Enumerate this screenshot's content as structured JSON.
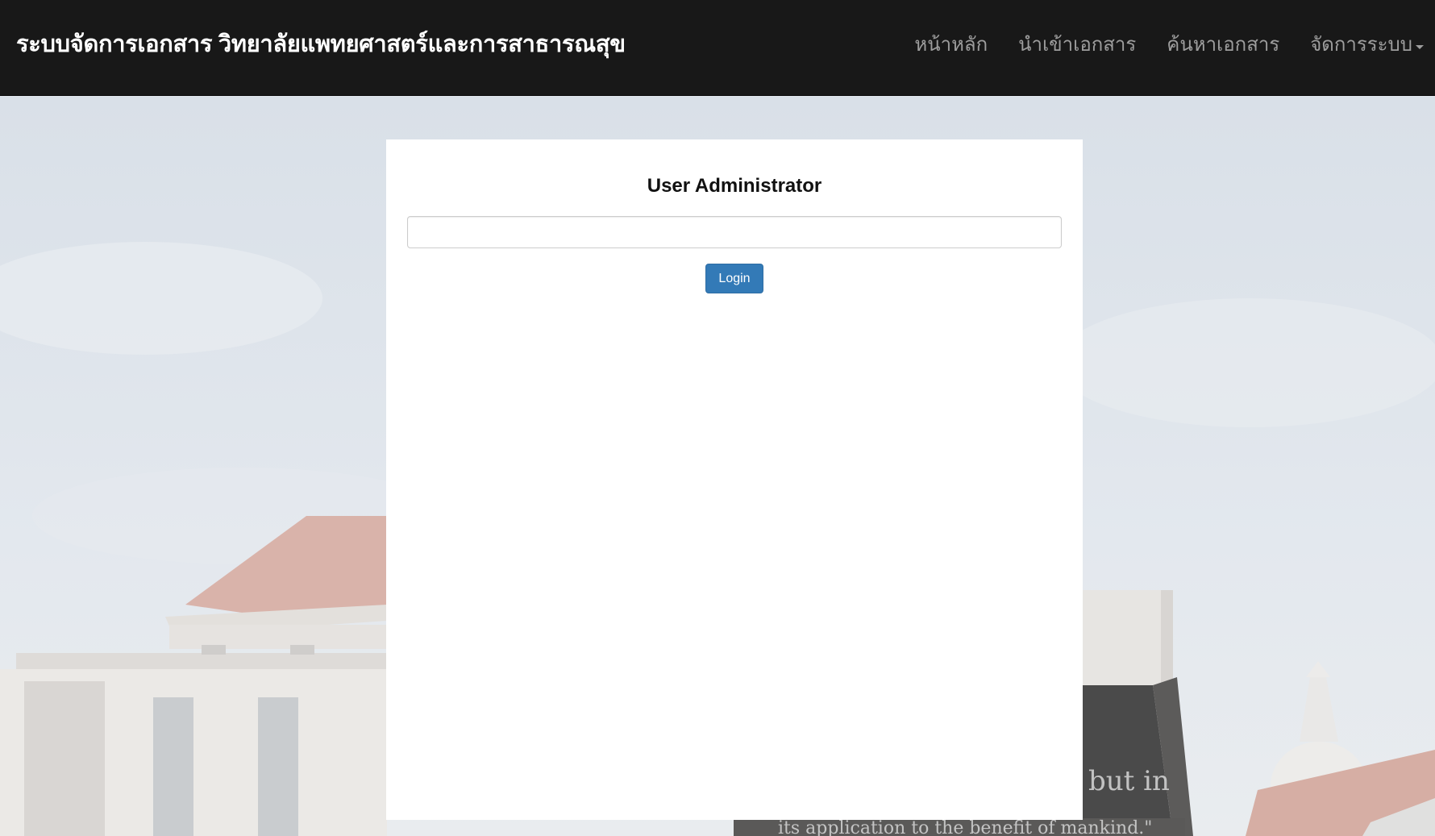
{
  "navbar": {
    "brand": "ระบบจัดการเอกสาร วิทยาลัยแพทยศาสตร์และการสาธารณสุข",
    "items": [
      {
        "label": "หน้าหลัก"
      },
      {
        "label": "นำเข้าเอกสาร"
      },
      {
        "label": "ค้นหาเอกสาร"
      },
      {
        "label": "จัดการระบบ"
      }
    ]
  },
  "login": {
    "title": "User Administrator",
    "input_value": "",
    "button_label": "Login"
  },
  "background": {
    "sign_text_line1": "but in",
    "sign_text_line2": "its application to the benefit of mankind.\""
  },
  "colors": {
    "navbar_bg": "#181818",
    "brand_text": "#ffffff",
    "nav_text": "#9d9d9d",
    "primary_button": "#337ab7"
  },
  "icons": {
    "dropdown": "caret-down-icon"
  }
}
